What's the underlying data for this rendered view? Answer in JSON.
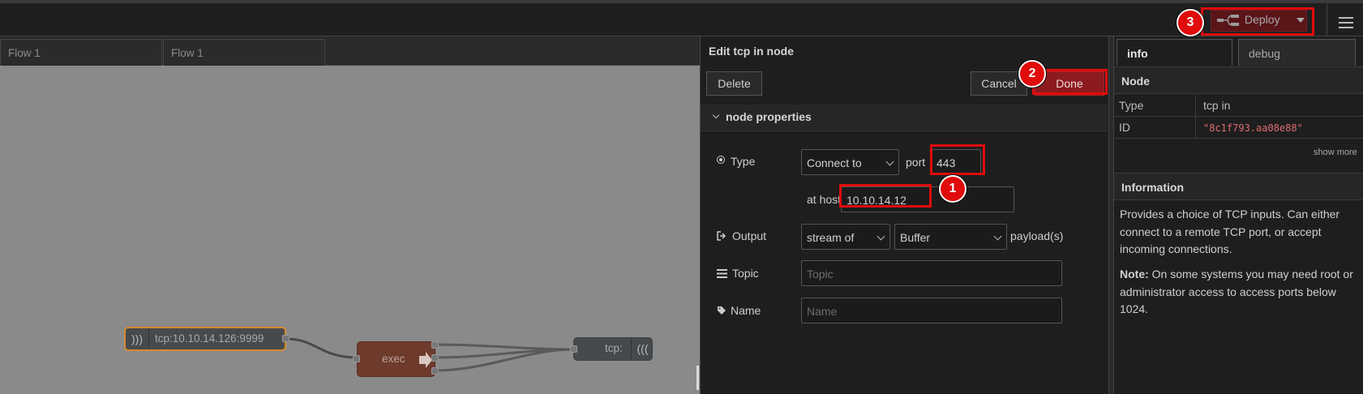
{
  "header": {
    "deploy_label": "Deploy",
    "menu_icon": "hamburger-icon"
  },
  "workspace": {
    "tabs": [
      {
        "label": "Flow 1"
      },
      {
        "label": "Flow 1"
      }
    ],
    "nodes": {
      "tcp_in_label": "tcp:10.10.14.126:9999",
      "exec_label": "exec",
      "tcp_out_label": "tcp:"
    }
  },
  "edit": {
    "title": "Edit tcp in node",
    "delete_label": "Delete",
    "cancel_label": "Cancel",
    "done_label": "Done",
    "section_label": "node properties",
    "type": {
      "label": "Type",
      "mode_value": "Connect to",
      "port_label": "port",
      "port_value": "443",
      "host_label": "at host",
      "host_value": "10.10.14.12"
    },
    "output": {
      "label": "Output",
      "stream_value": "stream of",
      "format_value": "Buffer",
      "suffix": "payload(s)"
    },
    "topic": {
      "label": "Topic",
      "placeholder": "Topic"
    },
    "name": {
      "label": "Name",
      "placeholder": "Name"
    }
  },
  "sidebar": {
    "tabs": [
      {
        "label": "info"
      },
      {
        "label": "debug"
      }
    ],
    "node_section": "Node",
    "rows": [
      {
        "key": "Type",
        "value": "tcp in"
      },
      {
        "key": "ID",
        "value": "\"8c1f793.aa08e88\""
      }
    ],
    "show_more": "show more",
    "info_section": "Information",
    "info_paragraph": "Provides a choice of TCP inputs. Can either connect to a remote TCP port, or accept incoming connections.",
    "note_bold": "Note:",
    "note_text": "On some systems you may need root or administrator access to access ports below 1024."
  },
  "annotations": [
    {
      "number": "1"
    },
    {
      "number": "2"
    },
    {
      "number": "3"
    }
  ],
  "colors": {
    "annotation_red": "#e00b0b",
    "done_button": "#8c1a1f",
    "deploy_button": "#5a1518",
    "exec_node": "#6e3a2c",
    "canvas_bg": "#8a8a8a",
    "id_text": "#e06c6c"
  }
}
